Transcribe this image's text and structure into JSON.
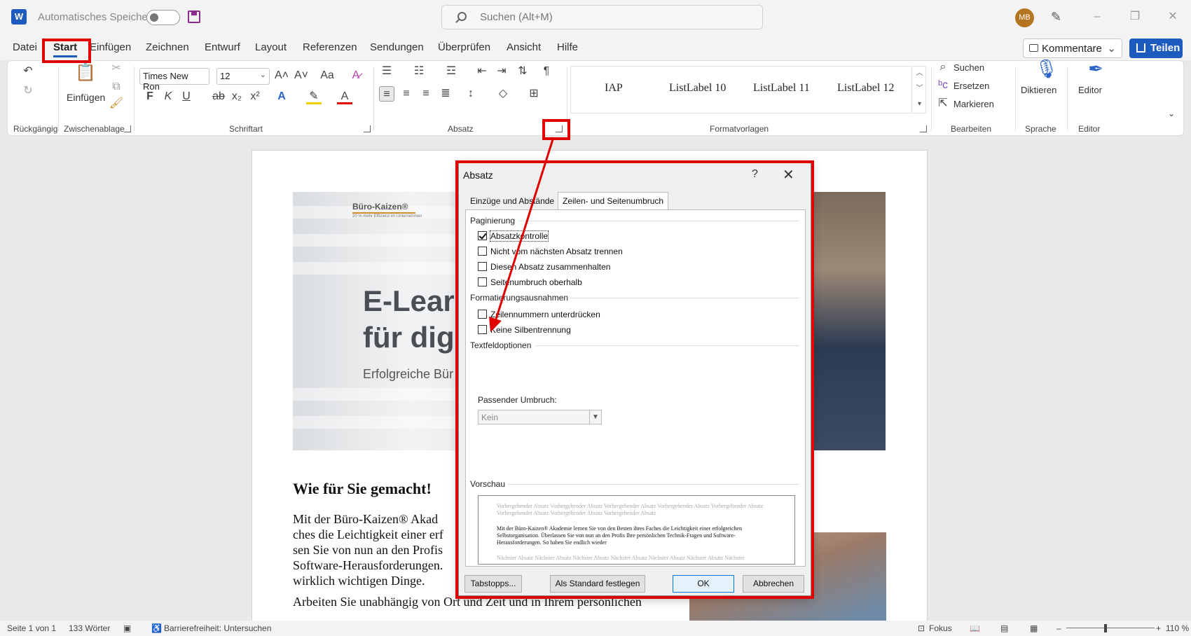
{
  "titlebar": {
    "app_letter": "W",
    "autosave_label": "Automatisches Speichern",
    "search_placeholder": "Suchen (Alt+M)",
    "avatar_initials": "MB",
    "window_controls": [
      "–",
      "❐",
      "✕"
    ]
  },
  "menu": {
    "tabs": [
      "Datei",
      "Start",
      "Einfügen",
      "Zeichnen",
      "Entwurf",
      "Layout",
      "Referenzen",
      "Sendungen",
      "Überprüfen",
      "Ansicht",
      "Hilfe"
    ],
    "active": "Start",
    "comment_button": "Kommentare",
    "share_button": "Teilen"
  },
  "ribbon": {
    "groups": {
      "undo": "Rückgängig",
      "clipboard": "Zwischenablage",
      "font": "Schriftart",
      "paragraph": "Absatz",
      "styles": "Formatvorlagen",
      "editing": "Bearbeiten",
      "voice": "Sprache",
      "editor": "Editor"
    },
    "paste_label": "Einfügen",
    "font_name": "Times New Ron",
    "font_size": "12",
    "font_buttons": [
      "F",
      "K",
      "U",
      "ab",
      "x₂",
      "x²"
    ],
    "styles": [
      "IAP",
      "ListLabel 10",
      "ListLabel 11",
      "ListLabel 12"
    ],
    "editing": {
      "find": "Suchen",
      "replace": "Ersetzen",
      "select": "Markieren"
    },
    "dictate_label": "Diktieren",
    "editor_label": "Editor"
  },
  "document": {
    "hero": {
      "brand": "Büro-Kaizen®",
      "brand_sub": "20 % mehr Effizienz im Unternehmen",
      "title": "E-Learn\nfür digi",
      "tagline": "Erfolgreiche Bür"
    },
    "heading": "Wie für Sie gemacht!",
    "paragraph": "Mit der Büro-Kaizen® Akad\nches die Leichtigkeit einer erf\nsen Sie von nun an den Profis\nSoftware-Herausforderungen.\nwirklich wichtigen Dinge.",
    "paragraph2": "Arbeiten Sie unabhängig von Ort und Zeit und in Ihrem persönlichen"
  },
  "statusbar": {
    "page": "Seite 1 von 1",
    "words": "133 Wörter",
    "accessibility": "Barrierefreiheit: Untersuchen",
    "focus": "Fokus",
    "zoom": "110 %"
  },
  "dialog": {
    "title": "Absatz",
    "help": "?",
    "close": "✕",
    "tabs": [
      "Einzüge und Abstände",
      "Zeilen- und Seitenumbruch"
    ],
    "active_tab": 1,
    "sections": {
      "pagination": "Paginierung",
      "formatting": "Formatierungsausnahmen",
      "textbox": "Textfeldoptionen",
      "preview": "Vorschau"
    },
    "pagination_options": [
      {
        "label": "Absatzkontrolle",
        "checked": true
      },
      {
        "label": "Nicht vom nächsten Absatz trennen",
        "checked": false
      },
      {
        "label": "Diesen Absatz zusammenhalten",
        "checked": false
      },
      {
        "label": "Seitenumbruch oberhalb",
        "checked": false
      }
    ],
    "formatting_options": [
      {
        "label": "Zeilennummern unterdrücken",
        "checked": false
      },
      {
        "label": "Keine Silbentrennung",
        "checked": false
      }
    ],
    "wrap_label": "Passender Umbruch:",
    "wrap_value": "Kein",
    "preview": {
      "before": "Vorhergehender Absatz Vorhergehender Absatz Vorhergehender Absatz Vorhergehender Absatz Vorhergehender Absatz Vorhergehender Absatz Vorhergehender Absatz Vorhergehender Absatz",
      "current": "Mit der Büro-Kaizen® Akademie lernen Sie von den Besten ihres Faches die Leichtigkeit einer erfolgreichen Selbstorganisation. Überlassen Sie von nun an den Profis Ihre persönlichen Technik-Fragen und Software-Herausforderungen. So haben Sie endlich wieder",
      "after": "Nächster Absatz Nächster Absatz Nächster Absatz Nächster Absatz Nächster Absatz Nächster Absatz Nächster"
    },
    "buttons": {
      "tabs": "Tabstopps...",
      "default": "Als Standard festlegen",
      "ok": "OK",
      "cancel": "Abbrechen"
    }
  },
  "colors": {
    "accent": "#1d5bbf",
    "annotation": "#e00000"
  }
}
